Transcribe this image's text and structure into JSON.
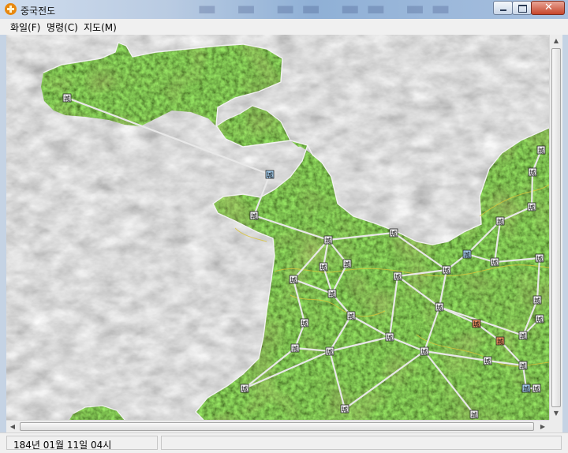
{
  "window": {
    "title": "중국전도",
    "close_glyph": "✕"
  },
  "menu": {
    "items": [
      {
        "label": "화일(F)"
      },
      {
        "label": "명령(C)"
      },
      {
        "label": "지도(M)"
      }
    ]
  },
  "map": {
    "city_glyph": "城",
    "colors": {
      "water": "#8c8c8c",
      "land": "#3f6b16",
      "road": "#e8e8e8",
      "river": "#d9c43a",
      "city_tile": "#ececec",
      "city_tile_highlight": "#9fc7e6",
      "city_tile_capital": "#e08a5a"
    }
  },
  "status": {
    "date_text": "184년  01월  11일  04시"
  }
}
